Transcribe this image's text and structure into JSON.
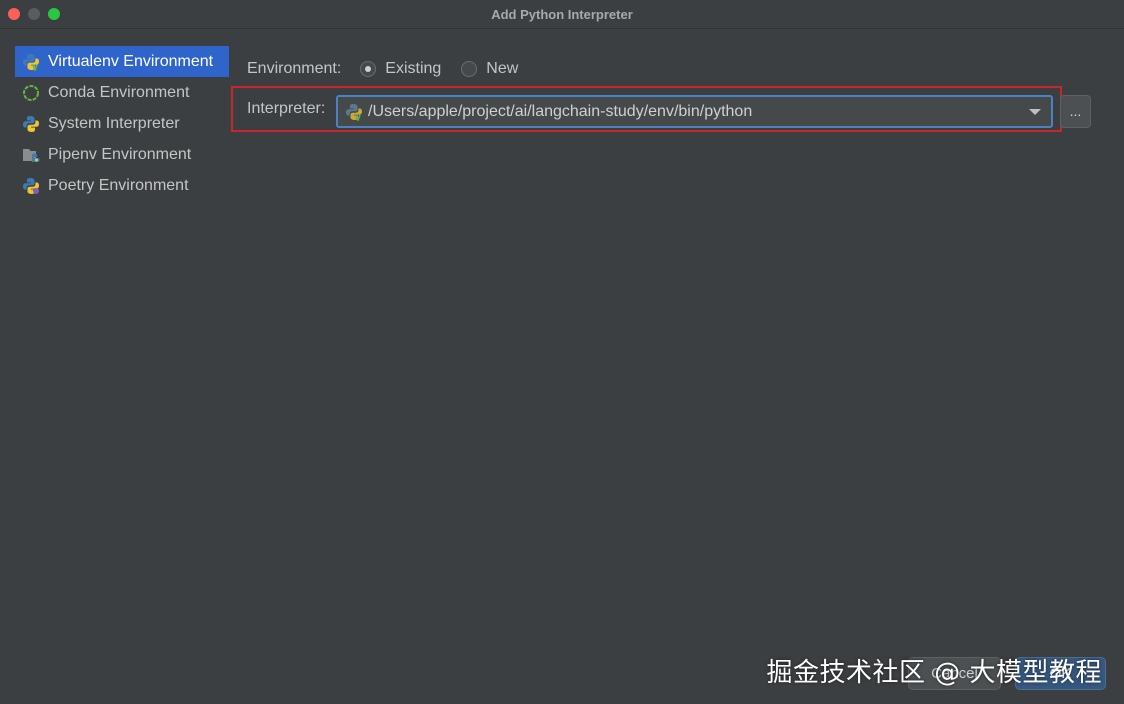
{
  "window": {
    "title": "Add Python Interpreter"
  },
  "sidebar": {
    "items": [
      {
        "label": "Virtualenv Environment",
        "icon": "python-virtualenv-icon",
        "selected": true
      },
      {
        "label": "Conda Environment",
        "icon": "conda-icon",
        "selected": false
      },
      {
        "label": "System Interpreter",
        "icon": "python-icon",
        "selected": false
      },
      {
        "label": "Pipenv Environment",
        "icon": "pipenv-icon",
        "selected": false
      },
      {
        "label": "Poetry Environment",
        "icon": "poetry-icon",
        "selected": false
      }
    ]
  },
  "environment": {
    "label": "Environment:",
    "options": [
      {
        "label": "Existing",
        "checked": true
      },
      {
        "label": "New",
        "checked": false
      }
    ]
  },
  "interpreter": {
    "label": "Interpreter:",
    "value": "/Users/apple/project/ai/langchain-study/env/bin/python",
    "browse_label": "..."
  },
  "buttons": {
    "cancel": "Cancel",
    "ok": "OK"
  },
  "watermark": "掘金技术社区 @ 大模型教程",
  "colors": {
    "background": "#3c3f41",
    "selection": "#2f65ca",
    "focus_border": "#4a82c4",
    "highlight_box": "#c9262b"
  }
}
